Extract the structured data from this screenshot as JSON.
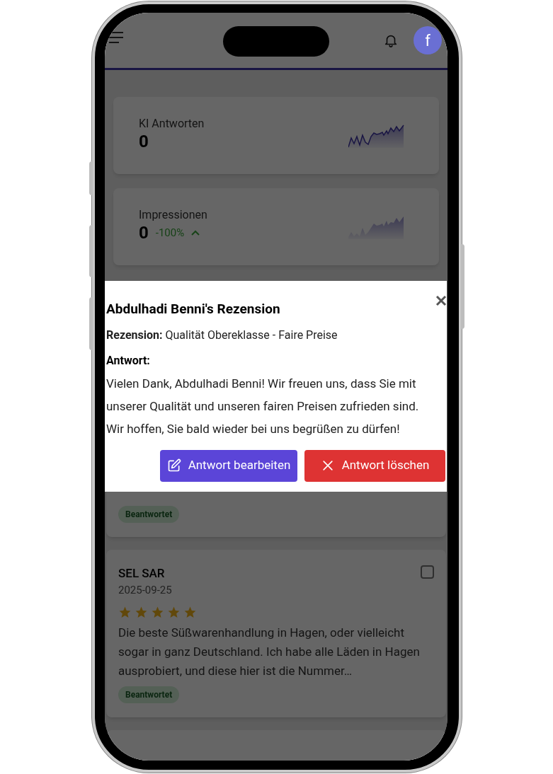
{
  "header": {
    "avatar_letter": "f"
  },
  "stats": [
    {
      "label": "KI Antworten",
      "value": "0",
      "kind": "line"
    },
    {
      "label": "Impressionen",
      "value": "0",
      "change": "-100%",
      "kind": "area"
    }
  ],
  "reviews": [
    {
      "status": "Beantwortet"
    },
    {
      "name": "SEL SAR",
      "date": "2025-09-25",
      "stars": 5,
      "text": "Die beste Süßwarenhandlung in Hagen, oder vielleicht sogar in ganz Deutschland. Ich habe alle Läden in Hagen ausprobiert, und diese hier ist die Nummer…",
      "status": "Beantwortet",
      "checked": false
    }
  ],
  "modal": {
    "title": "Abdulhadi Benni's Rezension",
    "review_label": "Rezension:",
    "review_text": "Qualität Obereklasse - Faire Preise",
    "answer_label": "Antwort:",
    "answer_text": "Vielen Dank, Abdulhadi Benni! Wir freuen uns, dass Sie mit unserer Qualität und unseren fairen Preisen zufrieden sind. Wir hoffen, Sie bald wieder bei uns begrüßen zu dürfen!",
    "buttons": [
      {
        "label": "Antwort bearbeiten",
        "kind": "edit"
      },
      {
        "label": "Antwort löschen",
        "kind": "delete"
      }
    ]
  }
}
